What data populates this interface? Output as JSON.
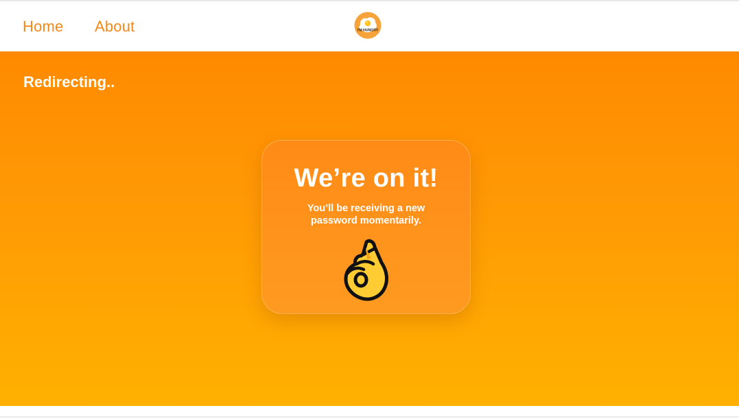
{
  "nav": {
    "home_label": "Home",
    "about_label": "About",
    "logo_text": "I'M HUNGRY",
    "link_color": "#f2891a"
  },
  "main": {
    "status_text": "Redirecting..",
    "gradient_top": "#ff8a00",
    "gradient_bottom": "#ffb100"
  },
  "card": {
    "title": "We’re on it!",
    "message": "You’ll be receiving a new password momentarily.",
    "icon": "ok-hand-icon"
  }
}
